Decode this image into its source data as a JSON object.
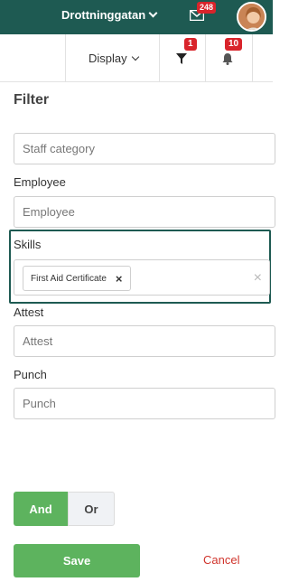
{
  "header": {
    "location": "Drottninggatan",
    "mail_count": "248",
    "colors": {
      "bar": "#1e5a52",
      "badge": "#d9242b"
    }
  },
  "toolbar": {
    "display_label": "Display",
    "filter_count": "1",
    "notification_count": "10"
  },
  "filter": {
    "title": "Filter",
    "fields": {
      "staff_category": {
        "placeholder": "Staff category"
      },
      "employee": {
        "label": "Employee",
        "placeholder": "Employee"
      },
      "skills": {
        "label": "Skills",
        "chip": "First Aid Certificate",
        "chip_remove": "×",
        "clear": "×"
      },
      "attest": {
        "label": "Attest",
        "placeholder": "Attest"
      },
      "punch": {
        "label": "Punch",
        "placeholder": "Punch"
      }
    },
    "logic": {
      "and_label": "And",
      "or_label": "Or",
      "selected": "And"
    },
    "save_label": "Save",
    "cancel_label": "Cancel"
  }
}
